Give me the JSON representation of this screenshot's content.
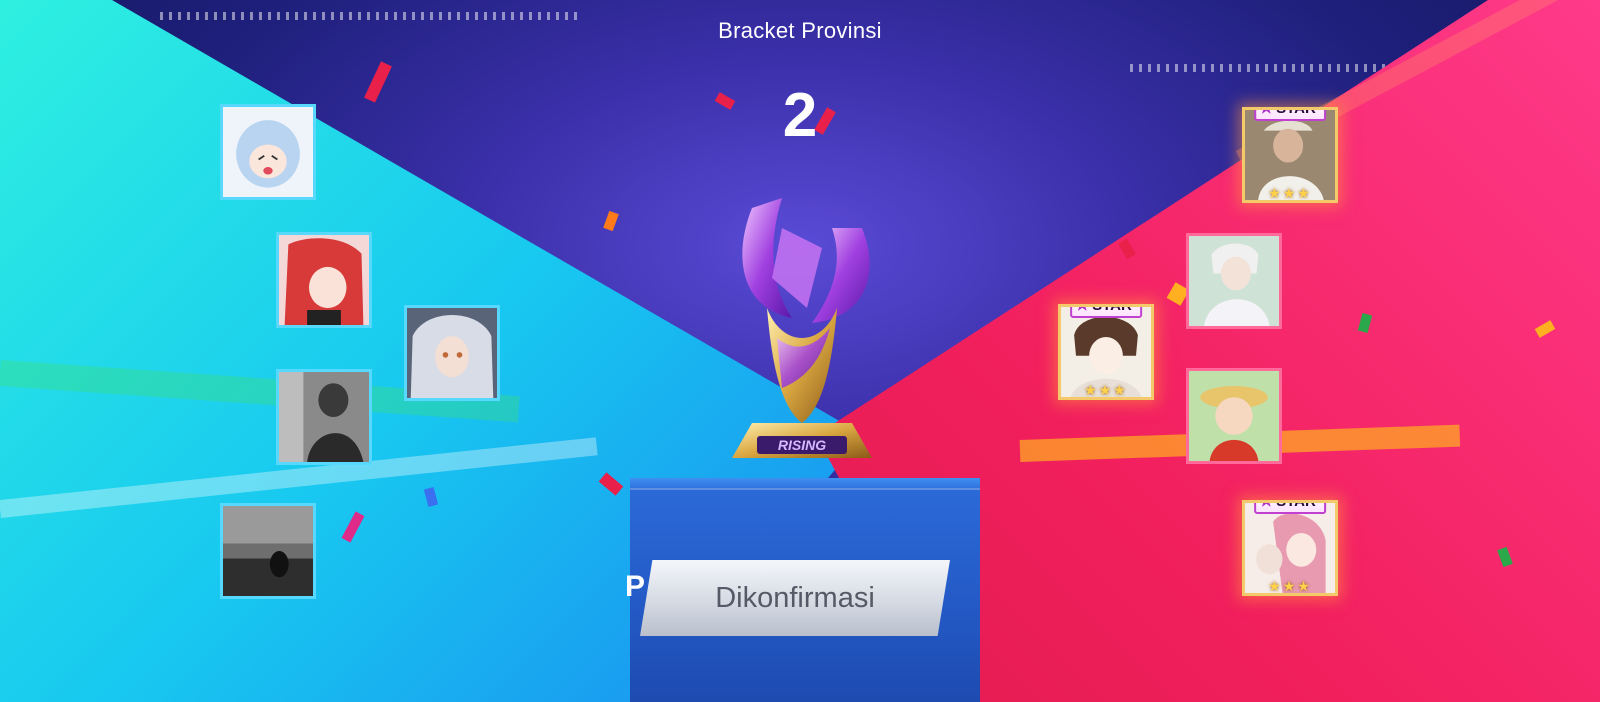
{
  "header": {
    "title": "Bracket Provinsi",
    "count": "2"
  },
  "confirm_button": {
    "label": "Dikonfirmasi",
    "partial_behind": "P"
  },
  "trophy": {
    "base_label": "RISING"
  },
  "left_team": {
    "accent": "#56d8ff",
    "players": [
      {
        "name": "player-avatar-1",
        "art": "chibi-blue-hair-anime-girl"
      },
      {
        "name": "player-avatar-2",
        "art": "red-hair-anime-girl"
      },
      {
        "name": "player-avatar-3",
        "art": "silver-hair-anime-character"
      },
      {
        "name": "player-avatar-4",
        "art": "grayscale-photo"
      },
      {
        "name": "player-avatar-5",
        "art": "grayscale-seascape-photo"
      }
    ]
  },
  "right_team": {
    "accent": "#ff6a9a",
    "star_label": "STAR",
    "players": [
      {
        "name": "player-avatar-6",
        "art": "photo-man-in-cap",
        "star": true
      },
      {
        "name": "player-avatar-7",
        "art": "white-hair-anime-man"
      },
      {
        "name": "player-avatar-8",
        "art": "manga-brown-hair-man",
        "star": true
      },
      {
        "name": "player-avatar-9",
        "art": "chibi-straw-hat-character"
      },
      {
        "name": "player-avatar-10",
        "art": "manga-pink-hair-couple",
        "star": true
      }
    ]
  }
}
